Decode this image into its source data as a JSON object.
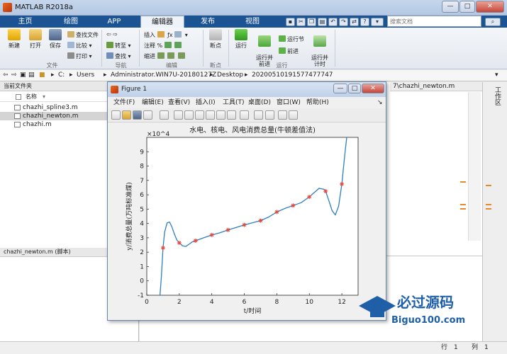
{
  "window": {
    "title": "MATLAB R2018a",
    "min": "—",
    "max": "□",
    "close": "✕"
  },
  "tabs": [
    {
      "label": "主页"
    },
    {
      "label": "绘图"
    },
    {
      "label": "APP"
    },
    {
      "label": "编辑器"
    },
    {
      "label": "发布"
    },
    {
      "label": "视图"
    }
  ],
  "search": {
    "placeholder": "搜索文档"
  },
  "ribbon": {
    "new": "新建",
    "open": "打开",
    "save": "保存",
    "find_files": "查找文件",
    "compare": "比较",
    "print": "打印",
    "goto": "转至",
    "find": "查找",
    "insert": "插入",
    "comment": "注释",
    "indent": "缩进",
    "breakpoints": "断点",
    "run": "运行",
    "run_advance": "运行并\n前进",
    "run_section": "运行节",
    "advance": "前进",
    "run_time": "运行并\n计时",
    "sections": {
      "file": "文件",
      "nav": "导航",
      "edit": "编辑",
      "breakpoints": "断点",
      "run": "运行"
    }
  },
  "address": {
    "c": "C:",
    "users": "Users",
    "admin": "Administrator.WIN7U-20180127Z",
    "desktop": "Desktop",
    "folder": "20200510191577477747"
  },
  "left": {
    "header": "当前文件夹",
    "col_name": "名称",
    "files": [
      "chazhi_spline3.m",
      "chazhi_newton.m",
      "chazhi.m"
    ],
    "details": "chazhi_newton.m (脚本)"
  },
  "editor": {
    "tab_label": "7\\chazhi_newton.m"
  },
  "right": {
    "label": "工作区"
  },
  "status": {
    "row_label": "行",
    "row": "1",
    "col_label": "列",
    "col": "1"
  },
  "figure": {
    "title": "Figure 1",
    "menu": [
      "文件(F)",
      "编辑(E)",
      "查看(V)",
      "插入(I)",
      "工具(T)",
      "桌面(D)",
      "窗口(W)",
      "帮助(H)"
    ]
  },
  "chart_data": {
    "type": "line",
    "title": "水电、核电、风电消费总量(牛顿差值法)",
    "xlabel": "t/时间",
    "ylabel": "y/消费总量(万吨标准煤)",
    "exponent": "×10^4",
    "xlim": [
      0,
      13
    ],
    "ylim": [
      -1,
      10
    ],
    "xticks": [
      0,
      2,
      4,
      6,
      8,
      10,
      12
    ],
    "yticks": [
      -1,
      0,
      1,
      2,
      3,
      4,
      5,
      6,
      7,
      8,
      9
    ],
    "points": {
      "x": [
        1,
        2,
        3,
        4,
        5,
        6,
        7,
        8,
        9,
        10,
        11,
        12
      ],
      "y": [
        2.3,
        2.65,
        2.8,
        3.2,
        3.55,
        3.9,
        4.2,
        4.8,
        5.25,
        5.85,
        6.25,
        6.75
      ]
    },
    "curve": {
      "x": [
        0.8,
        0.9,
        1.0,
        1.1,
        1.25,
        1.4,
        1.55,
        1.7,
        1.85,
        2.0,
        2.2,
        2.4,
        2.6,
        2.8,
        3.0,
        3.5,
        4.0,
        4.5,
        5.0,
        5.5,
        6.0,
        6.5,
        7.0,
        7.5,
        8.0,
        8.5,
        9.0,
        9.5,
        10.0,
        10.3,
        10.6,
        10.9,
        11.0,
        11.2,
        11.4,
        11.6,
        11.8,
        12.0,
        12.1,
        12.2,
        12.3
      ],
      "y": [
        -1.2,
        0.3,
        2.3,
        3.4,
        4.05,
        4.1,
        3.75,
        3.25,
        2.85,
        2.65,
        2.45,
        2.4,
        2.55,
        2.72,
        2.8,
        3.0,
        3.2,
        3.35,
        3.55,
        3.72,
        3.9,
        4.05,
        4.2,
        4.45,
        4.8,
        5.05,
        5.25,
        5.45,
        5.85,
        6.15,
        6.45,
        6.38,
        6.25,
        5.6,
        4.9,
        4.6,
        5.2,
        6.75,
        7.9,
        9.0,
        10.0
      ]
    },
    "color": "#2f7fc1",
    "marker_color": "#e3473a"
  },
  "watermark": {
    "title": "必过源码",
    "url": "Biguo100.com"
  }
}
